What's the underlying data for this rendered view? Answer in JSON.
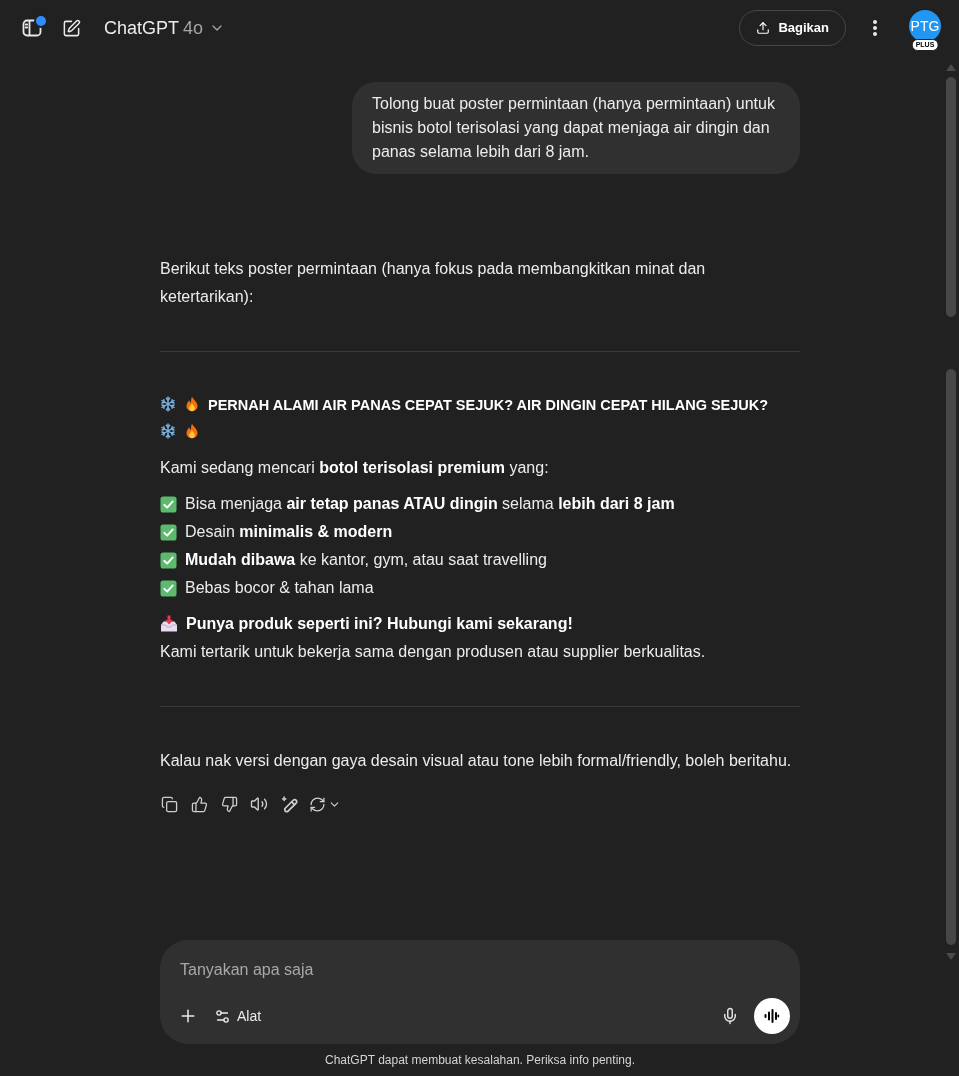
{
  "header": {
    "sidebar_toggle": {
      "notification": true
    },
    "model_selector": {
      "name": "ChatGPT",
      "version": "4o"
    },
    "share_button": {
      "label": "Bagikan"
    },
    "avatar": {
      "initials": "PTG",
      "badge": "PLUS"
    }
  },
  "messages": [
    {
      "kind": "bubble",
      "text": "Tolong buat poster permintaan (hanya permintaan) untuk bisnis botol terisolasi yang dapat menjaga air dingin dan panas selama lebih dari 8 jam."
    },
    {
      "kind": "reply",
      "blocks": [
        {
          "kind": "paragraph",
          "text": "Berikut teks poster permintaan (hanya fokus pada membangkitkan minat dan ketertarikan):"
        },
        {
          "kind": "divider"
        },
        {
          "kind": "heading",
          "text": "PERNAH ALAMI AIR PANAS CEPAT SEJUK? AIR DINGIN CEPAT HILANG SEJUK?"
        },
        {
          "kind": "paragraph",
          "text": "Kami sedang mencari **botol terisolasi premium** yang:"
        },
        {
          "kind": "checklist",
          "items": [
            "Bisa menjaga **air tetap panas ATAU dingin** selama **lebih dari 8 jam**",
            "Desain **minimalis & modern**",
            "**Mudah dibawa** ke kantor, gym, atau saat travelling",
            "Bebas bocor & tahan lama"
          ]
        },
        {
          "kind": "callout",
          "title": "Punya produk seperti ini? Hubungi kami sekarang!",
          "text": "Kami tertarik untuk bekerja sama dengan produsen atau supplier berkualitas."
        },
        {
          "kind": "divider"
        },
        {
          "kind": "paragraph",
          "text": "Kalau nak versi dengan gaya desain visual atau tone lebih formal/friendly, boleh beritahu."
        }
      ]
    }
  ],
  "composer": {
    "placeholder": "Tanyakan apa saja",
    "tools_button": "Alat"
  },
  "footer_note": "ChatGPT dapat membuat kesalahan. Periksa info penting."
}
